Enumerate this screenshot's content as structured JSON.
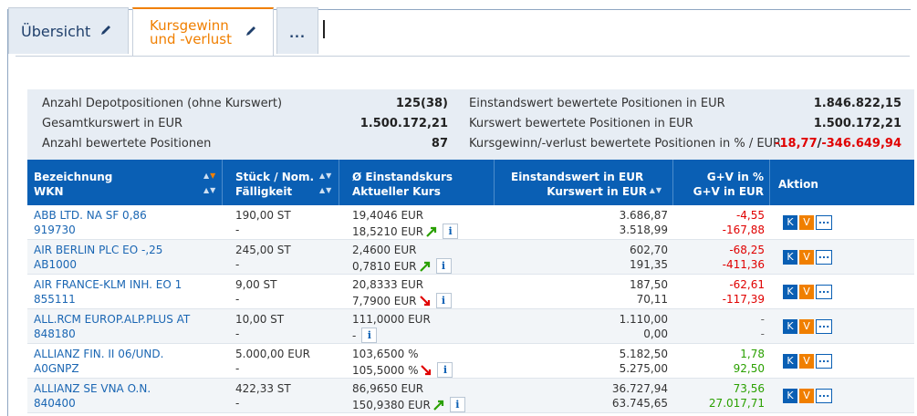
{
  "tabs": [
    {
      "label": "Übersicht"
    },
    {
      "label_line1": "Kursgewinn",
      "label_line2": "und -verlust"
    },
    {
      "label": "..."
    }
  ],
  "summary": {
    "left": [
      {
        "label": "Anzahl Depotpositionen (ohne Kurswert)",
        "value": "125(38)"
      },
      {
        "label": "Gesamtkurswert in EUR",
        "value": "1.500.172,21"
      },
      {
        "label": "Anzahl bewertete Positionen",
        "value": "87"
      }
    ],
    "right": [
      {
        "label": "Einstandswert bewertete Positionen in EUR",
        "value": "1.846.822,15"
      },
      {
        "label": "Kurswert bewertete Positionen in EUR",
        "value": "1.500.172,21"
      },
      {
        "label": "Kursgewinn/-verlust bewertete Positionen in % / EUR",
        "value_pct": "-18,77",
        "value_sep": "/",
        "value_eur": "-346.649,94"
      }
    ]
  },
  "table": {
    "headers": {
      "name1": "Bezeichnung",
      "name2": "WKN",
      "qty1": "Stück / Nom.",
      "qty2": "Fälligkeit",
      "px1": "Ø Einstandskurs",
      "px2": "Aktueller Kurs",
      "ev1": "Einstandswert in EUR",
      "ev2": "Kurswert in EUR",
      "gv1": "G+V in %",
      "gv2": "G+V in EUR",
      "action": "Aktion"
    },
    "rows": [
      {
        "name": "ABB LTD. NA SF 0,86",
        "wkn": "919730",
        "qty": "190,00 ST",
        "due": "-",
        "buy": "19,4046 EUR",
        "cur": "18,5210 EUR",
        "trend": "up",
        "ev": "3.686,87",
        "kv": "3.518,99",
        "gvp": "-4,55",
        "gve": "-167,88",
        "gv_color": "red"
      },
      {
        "name": "AIR BERLIN PLC EO -,25",
        "wkn": "AB1000",
        "qty": "245,00 ST",
        "due": "-",
        "buy": "2,4600 EUR",
        "cur": "0,7810 EUR",
        "trend": "up",
        "ev": "602,70",
        "kv": "191,35",
        "gvp": "-68,25",
        "gve": "-411,36",
        "gv_color": "red"
      },
      {
        "name": "AIR FRANCE-KLM INH. EO 1",
        "wkn": "855111",
        "qty": "9,00 ST",
        "due": "-",
        "buy": "20,8333 EUR",
        "cur": "7,7900 EUR",
        "trend": "down",
        "ev": "187,50",
        "kv": "70,11",
        "gvp": "-62,61",
        "gve": "-117,39",
        "gv_color": "red"
      },
      {
        "name": "ALL.RCM EUROP.ALP.PLUS AT",
        "wkn": "848180",
        "qty": "10,00 ST",
        "due": "-",
        "buy": "111,0000 EUR",
        "cur": "-",
        "trend": "none",
        "ev": "1.110,00",
        "kv": "0,00",
        "gvp": "-",
        "gve": "-",
        "gv_color": "dash"
      },
      {
        "name": "ALLIANZ FIN. II 06/UND.",
        "wkn": "A0GNPZ",
        "qty": "5.000,00 EUR",
        "due": "-",
        "buy": "103,6500 %",
        "cur": "105,5000 %",
        "trend": "down",
        "ev": "5.182,50",
        "kv": "5.275,00",
        "gvp": "1,78",
        "gve": "92,50",
        "gv_color": "green"
      },
      {
        "name": "ALLIANZ SE VNA O.N.",
        "wkn": "840400",
        "qty": "422,33 ST",
        "due": "-",
        "buy": "86,9650 EUR",
        "cur": "150,9380 EUR",
        "trend": "up",
        "ev": "36.727,94",
        "kv": "63.745,65",
        "gvp": "73,56",
        "gve": "27.017,71",
        "gv_color": "green"
      }
    ],
    "action_buttons": {
      "k": "K",
      "v": "V",
      "more": "..."
    }
  },
  "colors": {
    "primary": "#0a5fb4",
    "accent": "#f07f00",
    "negative": "#e00000",
    "positive": "#2aa000"
  }
}
